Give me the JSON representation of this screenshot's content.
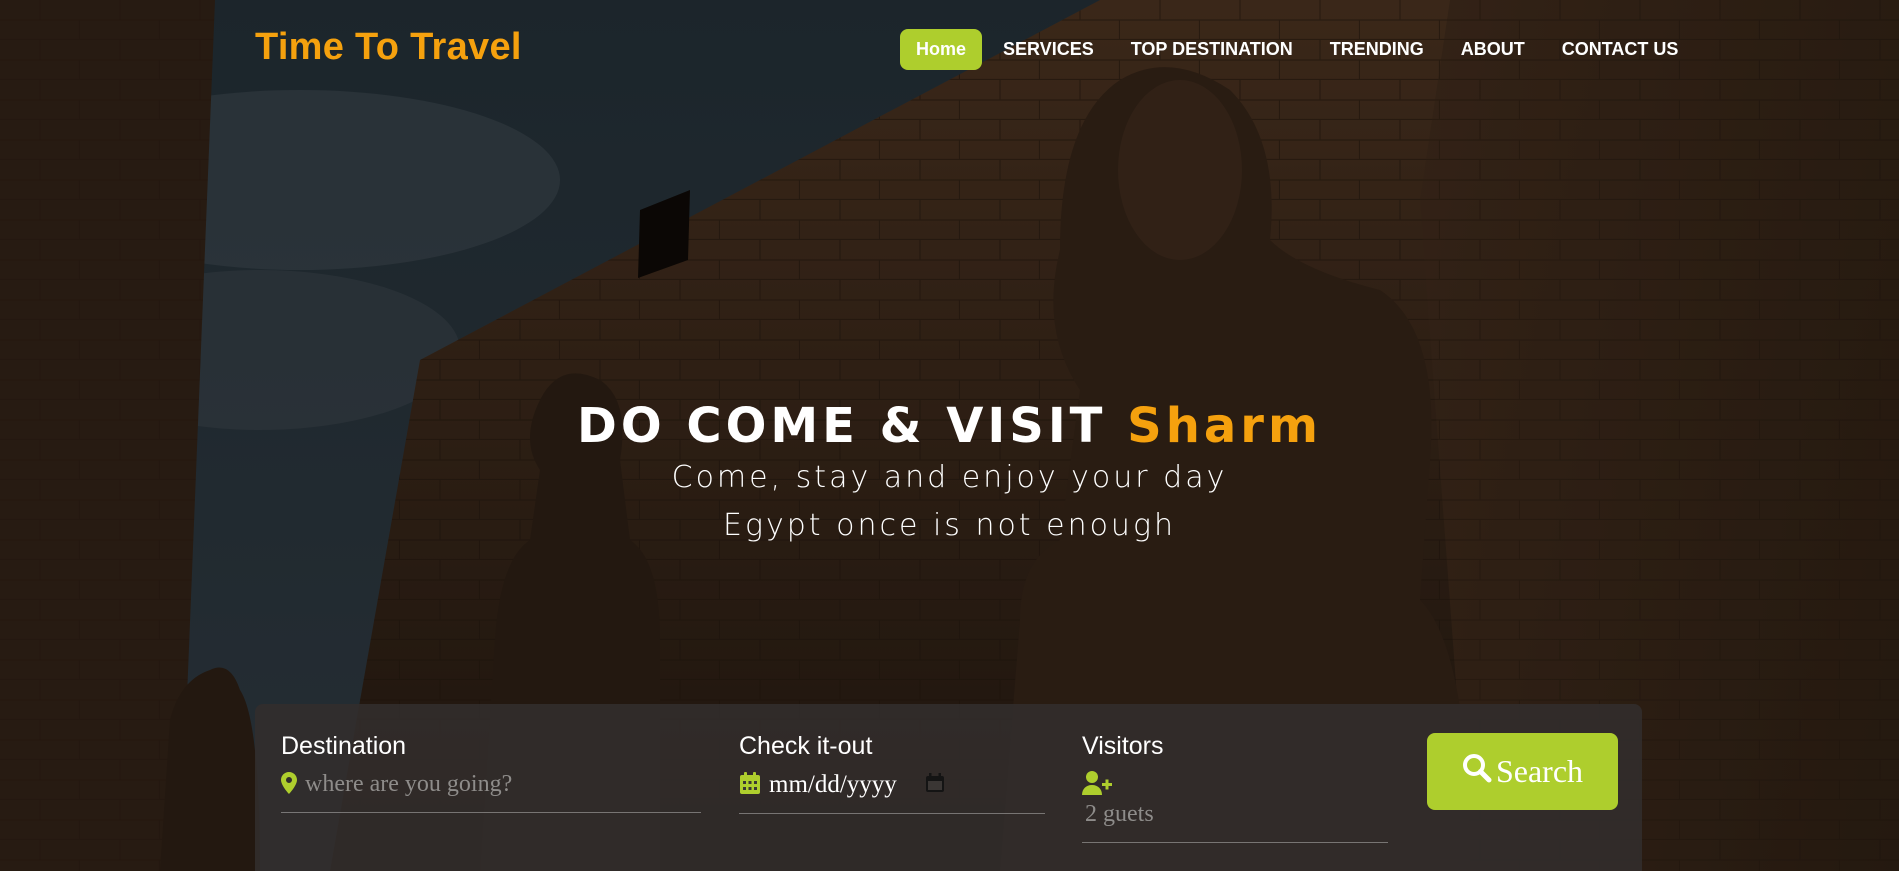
{
  "brand": {
    "name": "Time To Travel"
  },
  "nav": {
    "items": [
      {
        "label": "Home",
        "active": true
      },
      {
        "label": "SERVICES"
      },
      {
        "label": "TOP DESTINATION"
      },
      {
        "label": "TRENDING"
      },
      {
        "label": "ABOUT"
      },
      {
        "label": "CONTACT US"
      }
    ]
  },
  "hero": {
    "title_prefix": "DO COME & VISIT ",
    "title_accent": "Sharm",
    "line1": "Come, stay and enjoy your day",
    "line2": "Egypt once is not enough"
  },
  "search": {
    "destination": {
      "label": "Destination",
      "placeholder": "where are you going?",
      "icon": "map-marker-icon"
    },
    "checkout": {
      "label": "Check it-out",
      "value": "mm/dd/yyyy",
      "icon": "calendar-icon"
    },
    "visitors": {
      "label": "Visitors",
      "value": "2 guets",
      "icon": "user-plus-icon"
    },
    "button": {
      "label": "Search",
      "icon": "search-icon"
    }
  },
  "colors": {
    "accent_orange": "#f5a10e",
    "accent_green": "#aece2d"
  }
}
